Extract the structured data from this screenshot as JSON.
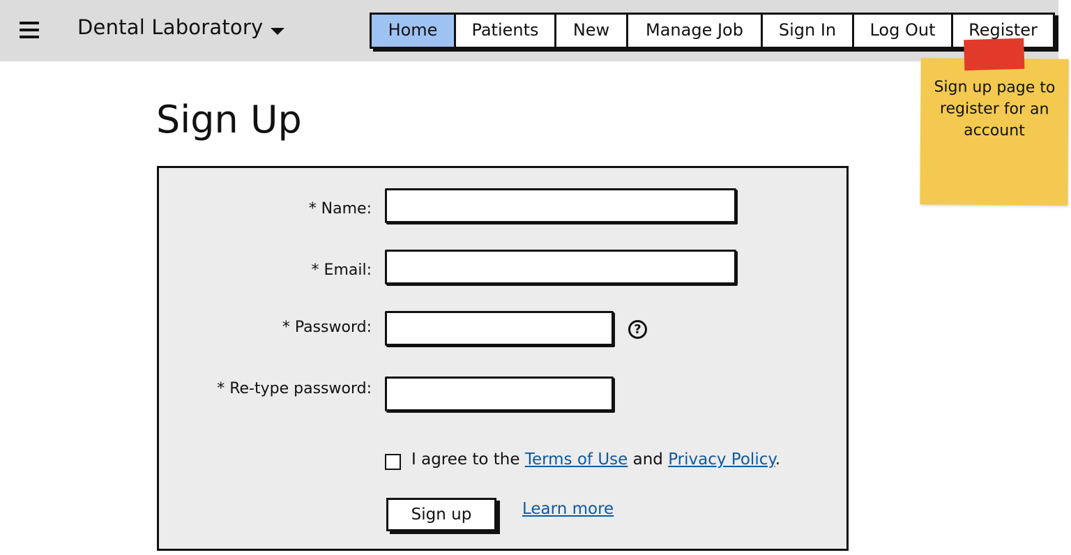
{
  "header": {
    "menu_icon": "hamburger-icon",
    "app_title": "Dental Laboratory",
    "dropdown_icon": "caret-down-icon",
    "nav": [
      {
        "label": "Home",
        "active": true
      },
      {
        "label": "Patients",
        "active": false
      },
      {
        "label": "New",
        "active": false
      },
      {
        "label": "Manage Job",
        "active": false
      },
      {
        "label": "Sign In",
        "active": false
      },
      {
        "label": "Log Out",
        "active": false
      },
      {
        "label": "Register",
        "active": false
      }
    ]
  },
  "note": {
    "text": "Sign up page to register for an account",
    "colors": {
      "paper": "#f3ca4f",
      "tape": "#e23a2a"
    }
  },
  "page": {
    "title": "Sign Up"
  },
  "form": {
    "name_label": "* Name:",
    "name_value": "",
    "email_label": "* Email:",
    "email_value": "",
    "password_label": "* Password:",
    "password_value": "",
    "password_help_icon": "question-circle-icon",
    "password_help_glyph": "?",
    "retype_label": "* Re-type password:",
    "retype_value": "",
    "agree_checked": false,
    "agree_prefix": "I agree to the",
    "terms_link": "Terms of Use",
    "agree_and": "and",
    "privacy_link": "Privacy Policy",
    "agree_suffix": ".",
    "submit_label": "Sign up",
    "learn_more": "Learn more"
  },
  "colors": {
    "header_bg": "#dcdcdc",
    "active_tab": "#9ec3f2",
    "form_bg": "#ececec",
    "link": "#0f5aa0"
  }
}
